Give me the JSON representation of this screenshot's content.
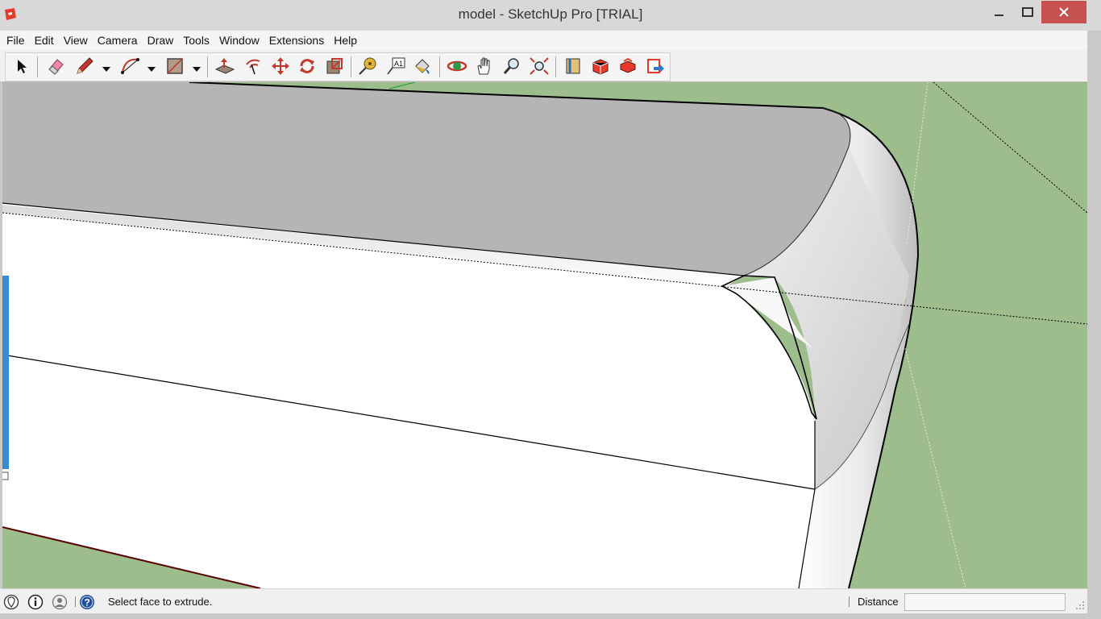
{
  "window": {
    "title": "model - SketchUp Pro [TRIAL]"
  },
  "menu": [
    "File",
    "Edit",
    "View",
    "Camera",
    "Draw",
    "Tools",
    "Window",
    "Extensions",
    "Help"
  ],
  "toolbar": {
    "tools": [
      {
        "name": "select-tool-icon"
      },
      {
        "name": "eraser-tool-icon"
      },
      {
        "name": "pencil-line-tool-icon"
      },
      {
        "name": "arc-tool-icon"
      },
      {
        "name": "rectangle-tool-icon"
      },
      {
        "name": "push-pull-tool-icon"
      },
      {
        "name": "offset-tool-icon"
      },
      {
        "name": "move-tool-icon"
      },
      {
        "name": "rotate-tool-icon"
      },
      {
        "name": "scale-tool-icon"
      },
      {
        "name": "tape-measure-tool-icon"
      },
      {
        "name": "text-tool-icon"
      },
      {
        "name": "paint-bucket-tool-icon"
      },
      {
        "name": "orbit-tool-icon"
      },
      {
        "name": "pan-tool-icon"
      },
      {
        "name": "zoom-tool-icon"
      },
      {
        "name": "zoom-extents-tool-icon"
      },
      {
        "name": "components-icon"
      },
      {
        "name": "warehouse-icon"
      },
      {
        "name": "extension-warehouse-icon"
      },
      {
        "name": "send-to-layout-icon"
      }
    ],
    "text_tool_glyph": "A1"
  },
  "colors": {
    "sky_ground": "#9dbd8c",
    "face_top": "#b5b5b5",
    "face_front": "#ffffff",
    "edge": "#000000",
    "close_button": "#c75050",
    "ruby_red": "#e8392d"
  },
  "status": {
    "message": "Select face to extrude.",
    "measurement_label": "Distance",
    "measurement_value": ""
  }
}
